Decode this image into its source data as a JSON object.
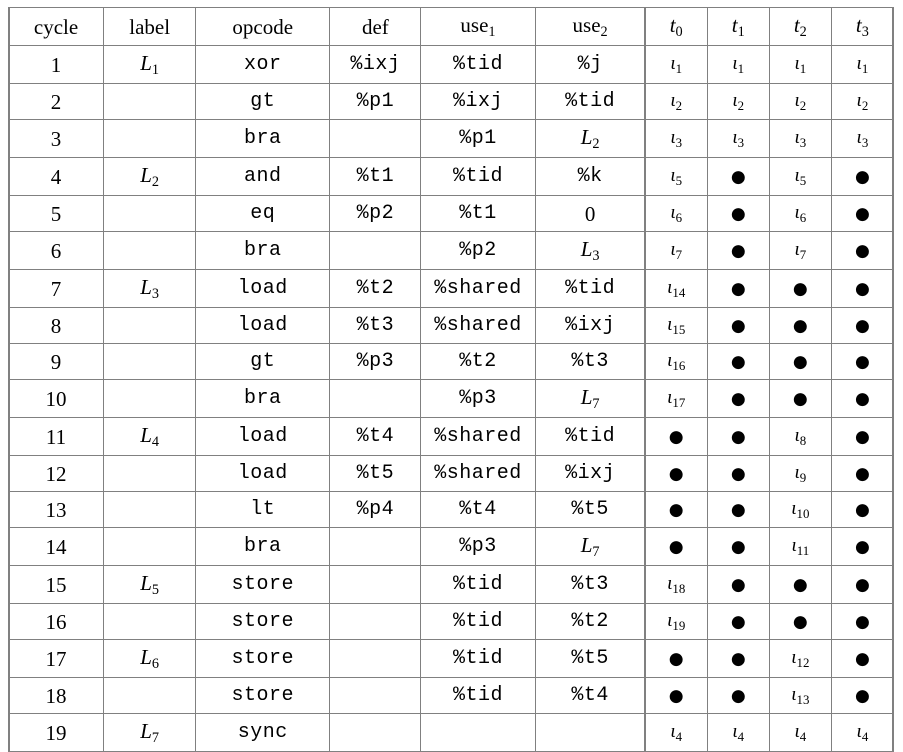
{
  "table": {
    "name": "instruction-schedule",
    "columns": [
      {
        "key": "cycle",
        "label": "cycle",
        "type": "num"
      },
      {
        "key": "label",
        "label": "label",
        "type": "mathit"
      },
      {
        "key": "opcode",
        "label": "opcode",
        "type": "mono"
      },
      {
        "key": "def",
        "label": "def",
        "type": "mono"
      },
      {
        "key": "use1",
        "label": "use",
        "sub": "1",
        "type": "mono"
      },
      {
        "key": "use2",
        "label": "use",
        "sub": "2",
        "type": "mono"
      },
      {
        "key": "t0",
        "label": "t",
        "sub": "0",
        "type": "iota"
      },
      {
        "key": "t1",
        "label": "t",
        "sub": "1",
        "type": "iota"
      },
      {
        "key": "t2",
        "label": "t",
        "sub": "2",
        "type": "iota"
      },
      {
        "key": "t3",
        "label": "t",
        "sub": "3",
        "type": "iota"
      }
    ],
    "bullet_glyph": "●",
    "iota_glyph": "ι",
    "rows": [
      {
        "cycle": "1",
        "label": "L",
        "label_sub": "1",
        "opcode": "xor",
        "def": "%ixj",
        "use1": "%tid",
        "use2": "%j",
        "use2_sub": "",
        "use2_style": "mono",
        "t0": "1",
        "t1": "1",
        "t2": "1",
        "t3": "1"
      },
      {
        "cycle": "2",
        "label": "",
        "label_sub": "",
        "opcode": "gt",
        "def": "%p1",
        "use1": "%ixj",
        "use2": "%tid",
        "use2_sub": "",
        "use2_style": "mono",
        "t0": "2",
        "t1": "2",
        "t2": "2",
        "t3": "2"
      },
      {
        "cycle": "3",
        "label": "",
        "label_sub": "",
        "opcode": "bra",
        "def": "",
        "use1": "%p1",
        "use2": "L",
        "use2_sub": "2",
        "use2_style": "mathit",
        "t0": "3",
        "t1": "3",
        "t2": "3",
        "t3": "3"
      },
      {
        "cycle": "4",
        "label": "L",
        "label_sub": "2",
        "opcode": "and",
        "def": "%t1",
        "use1": "%tid",
        "use2": "%k",
        "use2_sub": "",
        "use2_style": "mono",
        "t0": "5",
        "t1": "•",
        "t2": "5",
        "t3": "•"
      },
      {
        "cycle": "5",
        "label": "",
        "label_sub": "",
        "opcode": "eq",
        "def": "%p2",
        "use1": "%t1",
        "use2": "0",
        "use2_sub": "",
        "use2_style": "num",
        "t0": "6",
        "t1": "•",
        "t2": "6",
        "t3": "•"
      },
      {
        "cycle": "6",
        "label": "",
        "label_sub": "",
        "opcode": "bra",
        "def": "",
        "use1": "%p2",
        "use2": "L",
        "use2_sub": "3",
        "use2_style": "mathit",
        "t0": "7",
        "t1": "•",
        "t2": "7",
        "t3": "•"
      },
      {
        "cycle": "7",
        "label": "L",
        "label_sub": "3",
        "opcode": "load",
        "def": "%t2",
        "use1": "%shared",
        "use2": "%tid",
        "use2_sub": "",
        "use2_style": "mono",
        "t0": "14",
        "t1": "•",
        "t2": "•",
        "t3": "•"
      },
      {
        "cycle": "8",
        "label": "",
        "label_sub": "",
        "opcode": "load",
        "def": "%t3",
        "use1": "%shared",
        "use2": "%ixj",
        "use2_sub": "",
        "use2_style": "mono",
        "t0": "15",
        "t1": "•",
        "t2": "•",
        "t3": "•"
      },
      {
        "cycle": "9",
        "label": "",
        "label_sub": "",
        "opcode": "gt",
        "def": "%p3",
        "use1": "%t2",
        "use2": "%t3",
        "use2_sub": "",
        "use2_style": "mono",
        "t0": "16",
        "t1": "•",
        "t2": "•",
        "t3": "•"
      },
      {
        "cycle": "10",
        "label": "",
        "label_sub": "",
        "opcode": "bra",
        "def": "",
        "use1": "%p3",
        "use2": "L",
        "use2_sub": "7",
        "use2_style": "mathit",
        "t0": "17",
        "t1": "•",
        "t2": "•",
        "t3": "•"
      },
      {
        "cycle": "11",
        "label": "L",
        "label_sub": "4",
        "opcode": "load",
        "def": "%t4",
        "use1": "%shared",
        "use2": "%tid",
        "use2_sub": "",
        "use2_style": "mono",
        "t0": "•",
        "t1": "•",
        "t2": "8",
        "t3": "•"
      },
      {
        "cycle": "12",
        "label": "",
        "label_sub": "",
        "opcode": "load",
        "def": "%t5",
        "use1": "%shared",
        "use2": "%ixj",
        "use2_sub": "",
        "use2_style": "mono",
        "t0": "•",
        "t1": "•",
        "t2": "9",
        "t3": "•"
      },
      {
        "cycle": "13",
        "label": "",
        "label_sub": "",
        "opcode": "lt",
        "def": "%p4",
        "use1": "%t4",
        "use2": "%t5",
        "use2_sub": "",
        "use2_style": "mono",
        "t0": "•",
        "t1": "•",
        "t2": "10",
        "t3": "•"
      },
      {
        "cycle": "14",
        "label": "",
        "label_sub": "",
        "opcode": "bra",
        "def": "",
        "use1": "%p3",
        "use2": "L",
        "use2_sub": "7",
        "use2_style": "mathit",
        "t0": "•",
        "t1": "•",
        "t2": "11",
        "t3": "•"
      },
      {
        "cycle": "15",
        "label": "L",
        "label_sub": "5",
        "opcode": "store",
        "def": "",
        "use1": "%tid",
        "use2": "%t3",
        "use2_sub": "",
        "use2_style": "mono",
        "t0": "18",
        "t1": "•",
        "t2": "•",
        "t3": "•"
      },
      {
        "cycle": "16",
        "label": "",
        "label_sub": "",
        "opcode": "store",
        "def": "",
        "use1": "%tid",
        "use2": "%t2",
        "use2_sub": "",
        "use2_style": "mono",
        "t0": "19",
        "t1": "•",
        "t2": "•",
        "t3": "•"
      },
      {
        "cycle": "17",
        "label": "L",
        "label_sub": "6",
        "opcode": "store",
        "def": "",
        "use1": "%tid",
        "use2": "%t5",
        "use2_sub": "",
        "use2_style": "mono",
        "t0": "•",
        "t1": "•",
        "t2": "12",
        "t3": "•"
      },
      {
        "cycle": "18",
        "label": "",
        "label_sub": "",
        "opcode": "store",
        "def": "",
        "use1": "%tid",
        "use2": "%t4",
        "use2_sub": "",
        "use2_style": "mono",
        "t0": "•",
        "t1": "•",
        "t2": "13",
        "t3": "•"
      },
      {
        "cycle": "19",
        "label": "L",
        "label_sub": "7",
        "opcode": "sync",
        "def": "",
        "use1": "",
        "use2": "",
        "use2_sub": "",
        "use2_style": "mono",
        "t0": "4",
        "t1": "4",
        "t2": "4",
        "t3": "4"
      }
    ]
  }
}
